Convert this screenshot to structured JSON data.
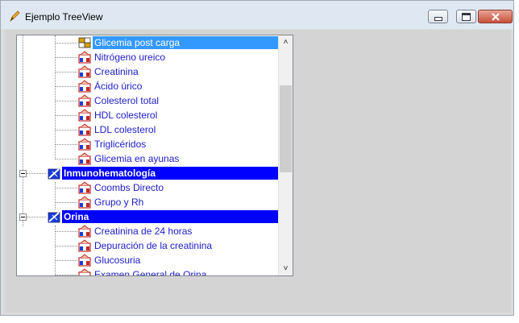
{
  "window": {
    "title": "Ejemplo TreeView",
    "icon": "pencil-icon"
  },
  "tree": {
    "selected_item": "Glicemia post carga",
    "items_group1": [
      "Glicemia post carga",
      "Nitrógeno ureico",
      "Creatinina",
      "Ácido úrico",
      "Colesterol total",
      "HDL colesterol",
      "LDL colesterol",
      "Triglicéridos",
      "Glicemia en ayunas"
    ],
    "category_immuno": "Inmunohematología",
    "items_immuno": [
      "Coombs Directo",
      "Grupo y Rh"
    ],
    "category_orina": "Orina",
    "items_orina": [
      "Creatinina de 24 horas",
      "Depuración de la creatinina",
      "Glucosuria",
      "Examen General de Orina"
    ]
  },
  "colors": {
    "selection": "#3399ff",
    "category": "#0000ff",
    "item_text": "#1c1cc8"
  }
}
